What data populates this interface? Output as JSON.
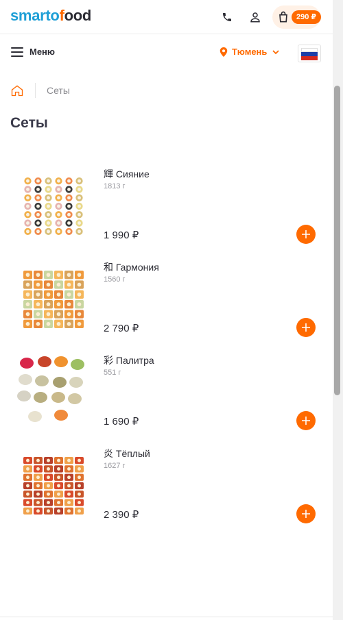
{
  "header": {
    "logo_part1": "smarto",
    "logo_part2": "f",
    "logo_part3": "ood",
    "cart_total": "290 ₽",
    "icons": [
      "phone-icon",
      "user-icon",
      "shopping-bag-icon"
    ],
    "accent_color": "#ff6a00",
    "logo_blue": "#1f9fd6"
  },
  "subbar": {
    "menu_label": "Меню",
    "city": "Тюмень",
    "flag": "Russia"
  },
  "breadcrumb": {
    "current": "Сеты"
  },
  "page_title": "Сеты",
  "products": [
    {
      "name": "輝 Сияние",
      "weight": "1813 г",
      "price": "1 990 ₽"
    },
    {
      "name": "和 Гармония",
      "weight": "1560 г",
      "price": "2 790 ₽"
    },
    {
      "name": "彩 Палитра",
      "weight": "551 г",
      "price": "1 690 ₽"
    },
    {
      "name": "炎 Тёплый",
      "weight": "1627 г",
      "price": "2 390 ₽"
    }
  ]
}
